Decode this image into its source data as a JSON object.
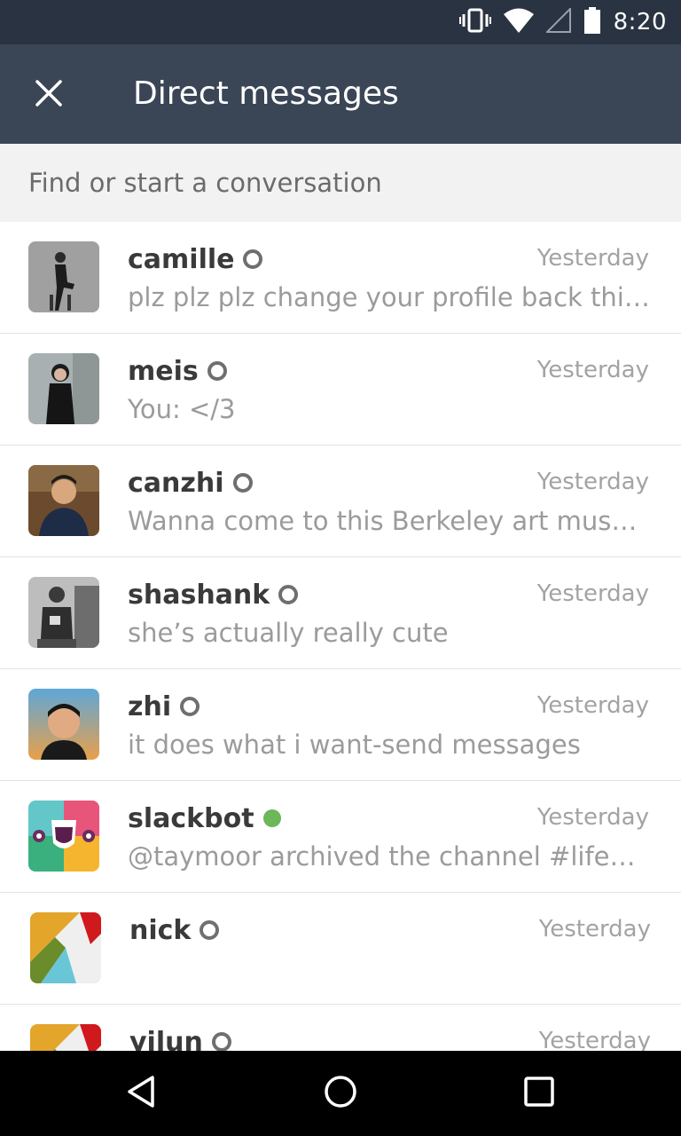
{
  "status_bar": {
    "time": "8:20",
    "icons": [
      "vibrate-icon",
      "wifi-icon",
      "signal-icon",
      "battery-icon"
    ]
  },
  "header": {
    "title": "Direct messages",
    "close_icon": "close-icon"
  },
  "search": {
    "placeholder": "Find or start a conversation"
  },
  "conversations": [
    {
      "name": "camille",
      "presence": "away",
      "time": "Yesterday",
      "preview": "plz plz plz change your profile back this is…"
    },
    {
      "name": "meis",
      "presence": "away",
      "time": "Yesterday",
      "preview": "You: </3"
    },
    {
      "name": "canzhi",
      "presence": "away",
      "time": "Yesterday",
      "preview": "Wanna come to this Berkeley art museum…"
    },
    {
      "name": "shashank",
      "presence": "away",
      "time": "Yesterday",
      "preview": "she’s actually really cute"
    },
    {
      "name": "zhi",
      "presence": "away",
      "time": "Yesterday",
      "preview": "it does what i want-send messages"
    },
    {
      "name": "slackbot",
      "presence": "active",
      "time": "Yesterday",
      "preview": "@taymoor archived the channel #lifeenric…"
    },
    {
      "name": "nick",
      "presence": "away",
      "time": "Yesterday",
      "preview": ""
    },
    {
      "name": "yilun",
      "presence": "away",
      "time": "Yesterday",
      "preview": ""
    }
  ],
  "colors": {
    "status_bar": "#2a3341",
    "app_bar": "#3a4656",
    "active_presence": "#6bb75a"
  },
  "nav": {
    "icons": [
      "back-icon",
      "home-icon",
      "recents-icon"
    ]
  }
}
